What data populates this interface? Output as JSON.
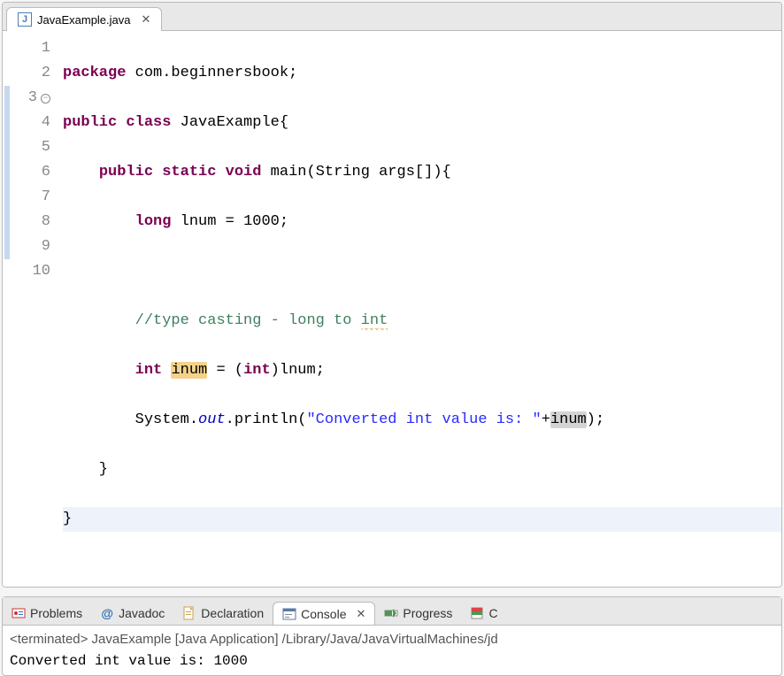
{
  "editor": {
    "tab": {
      "filename": "JavaExample.java"
    },
    "lines": [
      {
        "n": 1
      },
      {
        "n": 2
      },
      {
        "n": 3,
        "fold": true,
        "stripe": true
      },
      {
        "n": 4,
        "stripe": true
      },
      {
        "n": 5,
        "stripe": true
      },
      {
        "n": 6,
        "stripe": true
      },
      {
        "n": 7,
        "stripe": true
      },
      {
        "n": 8,
        "stripe": true
      },
      {
        "n": 9,
        "stripe": true
      },
      {
        "n": 10
      }
    ],
    "tokens": {
      "package": "package",
      "pkgname": "com.beginnersbook;",
      "public": "public",
      "class": "class",
      "classname": "JavaExample",
      "static": "static",
      "void": "void",
      "main": "main",
      "String": "String",
      "args": "args",
      "long": "long",
      "lnum": "lnum",
      "thousand": "1000",
      "comment": "//type casting - long to ",
      "comment_int": "int",
      "int": "int",
      "inum": "inum",
      "cast": "(int)lnum;",
      "System": "System",
      "out": "out",
      "println": "println",
      "strlit": "\"Converted int value is: \"",
      "plus_inum": "+",
      "eq": " = ",
      "semicolon": ";"
    }
  },
  "bottom": {
    "tabs": {
      "problems": "Problems",
      "javadoc": "Javadoc",
      "declaration": "Declaration",
      "console": "Console",
      "progress": "Progress",
      "last": "C"
    },
    "console": {
      "header": "<terminated> JavaExample [Java Application] /Library/Java/JavaVirtualMachines/jd",
      "output": "Converted int value is: 1000"
    }
  }
}
